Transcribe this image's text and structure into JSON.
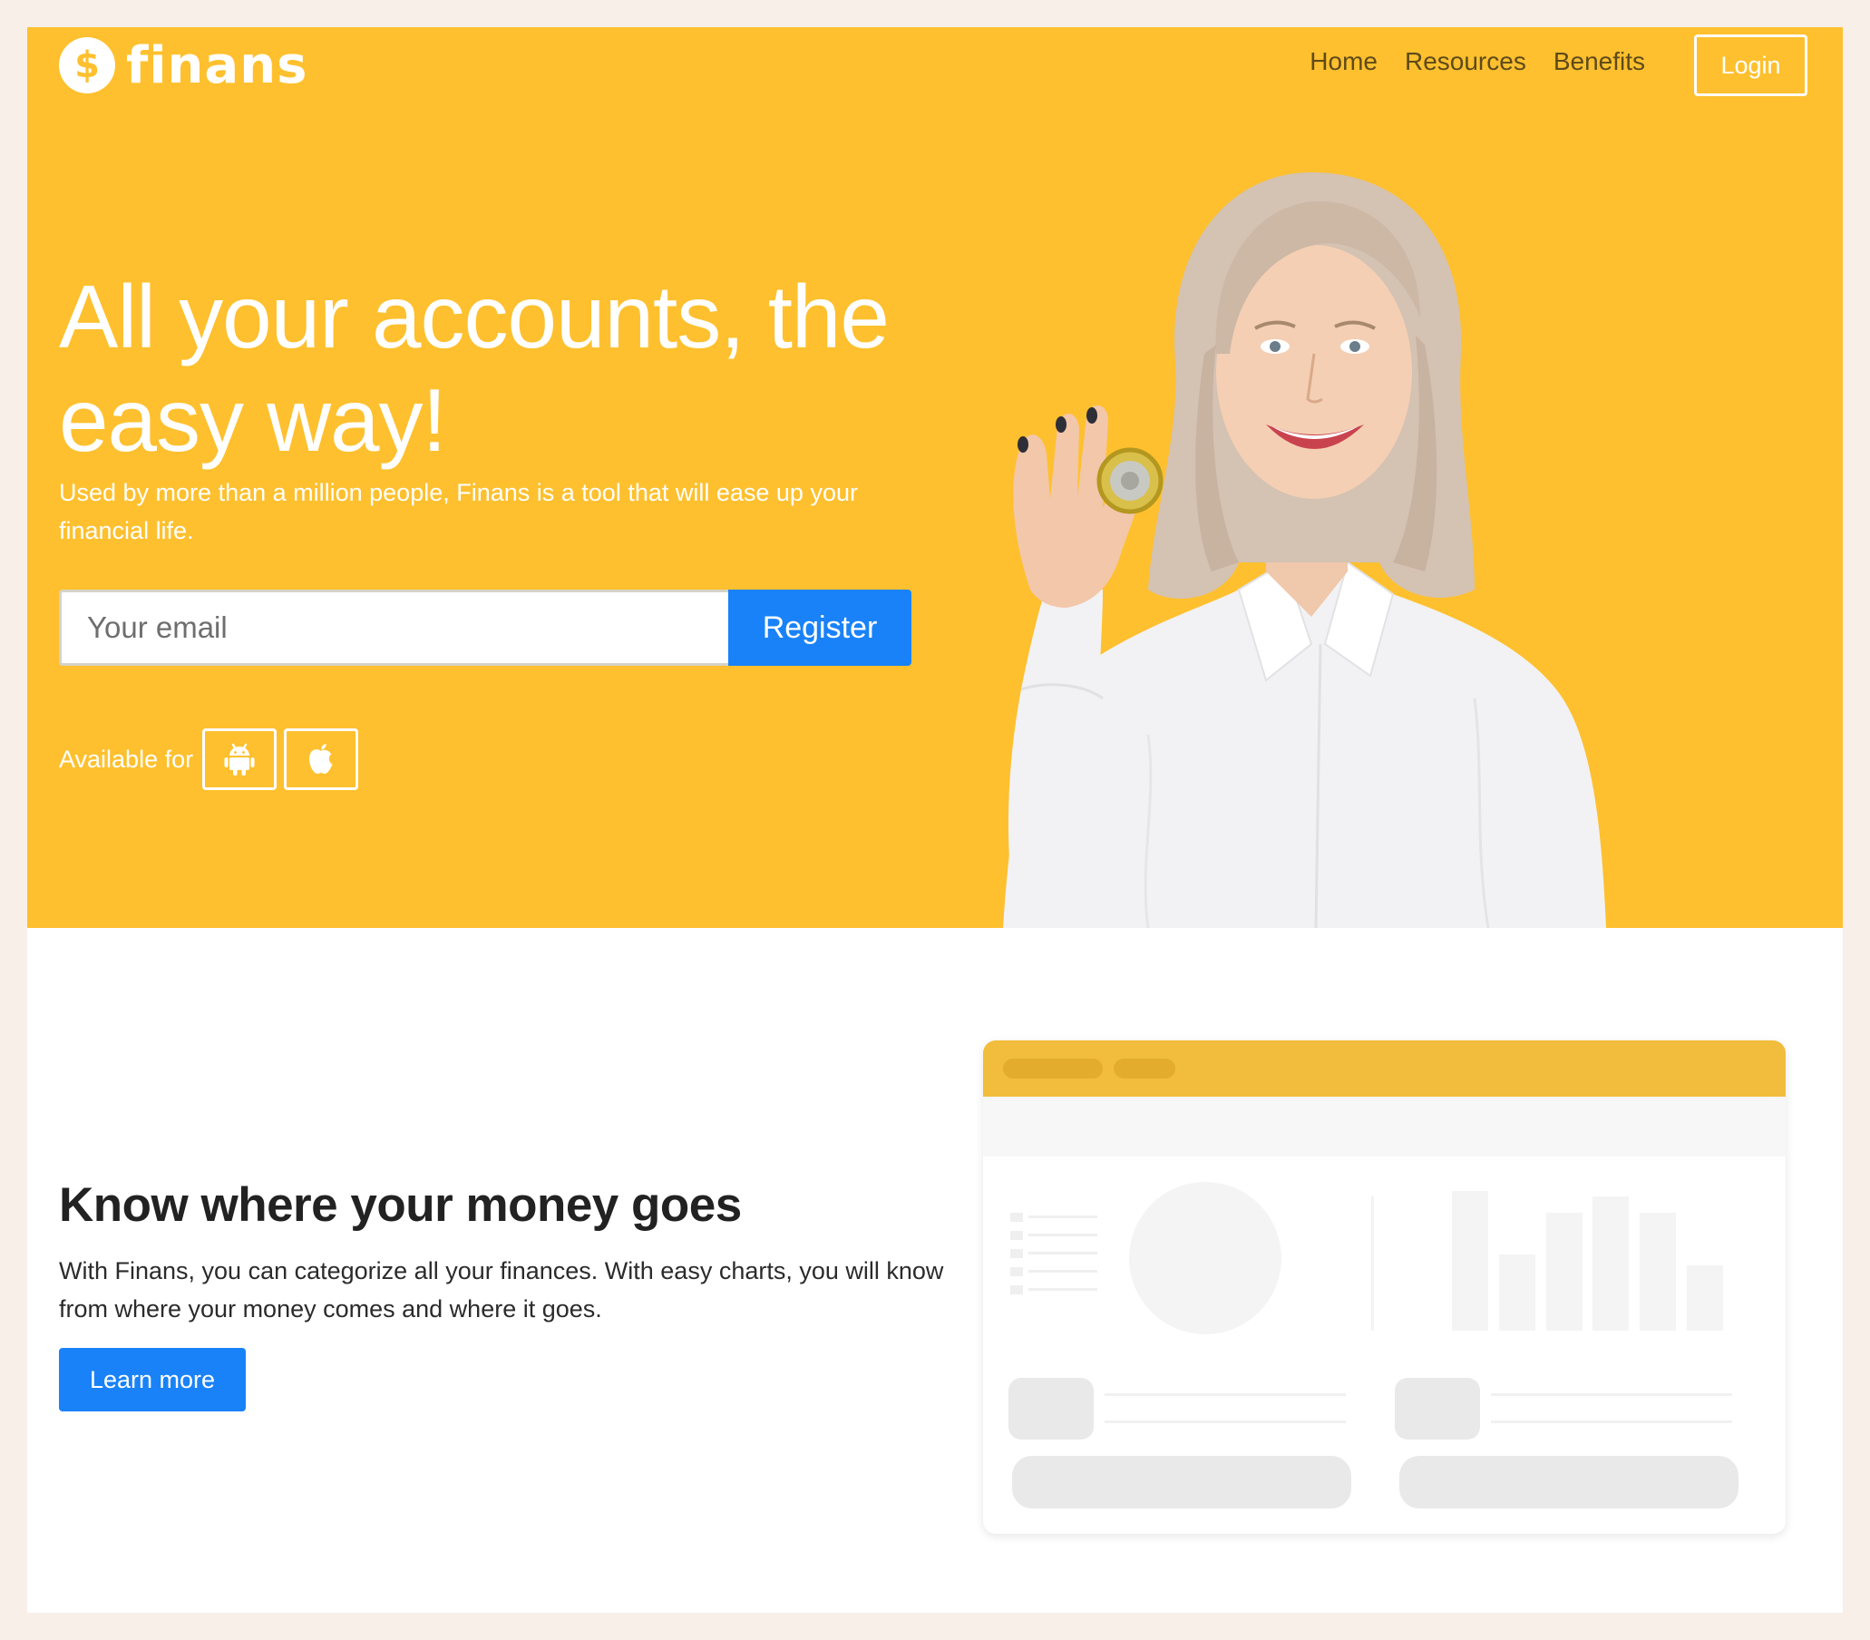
{
  "brand": {
    "name": "finans",
    "logo_icon": "dollar-coin-icon",
    "color": "#fec02e"
  },
  "nav": {
    "links": [
      "Home",
      "Resources",
      "Benefits"
    ],
    "login_label": "Login"
  },
  "hero": {
    "title": "All your accounts, the easy way!",
    "subtitle": "Used by more than a million people, Finans is a tool that will ease up your financial life.",
    "email_placeholder": "Your email",
    "register_label": "Register",
    "available_label": "Available for",
    "platform_icons": [
      "android-icon",
      "apple-icon"
    ]
  },
  "feature": {
    "title": "Know where your money goes",
    "text": "With Finans, you can categorize all your finances. With easy charts, you will know from where your money comes and where it goes.",
    "button_label": "Learn more"
  },
  "colors": {
    "hero_background": "#fec02e",
    "primary_button": "#1982f8",
    "page_frame": "#f8efe8"
  }
}
